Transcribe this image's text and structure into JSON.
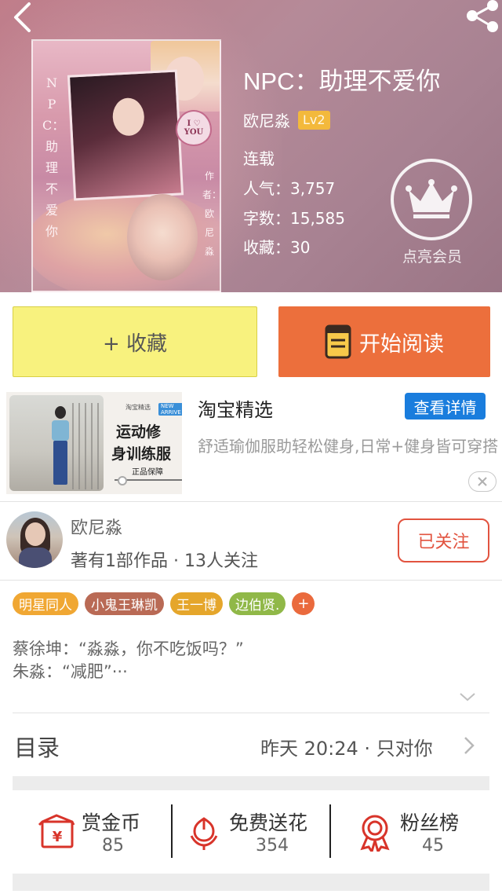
{
  "book": {
    "title": "NPC：助理不爱你",
    "cover_vertical_title": "NPC：助理不爱你",
    "cover_author": "作者：欧尼淼",
    "author": "欧尼淼",
    "level": "Lv2",
    "status": "连载",
    "popularity": "人气：3,757",
    "word_count": "字数：15,585",
    "favorites": "收藏：30",
    "vip_label": "点亮会员"
  },
  "actions": {
    "collect_label": "+ 收藏",
    "read_label": "开始阅读"
  },
  "ad": {
    "title": "淘宝精选",
    "detail_button": "查看详情",
    "description": "舒适瑜伽服助轻松健身,日常+健身皆可穿搭",
    "image_brand": "淘宝精选",
    "image_tag": "NEW ARRIVE",
    "image_line1": "运动修",
    "image_line2": "身训练服",
    "image_badge": "正品保障"
  },
  "author_card": {
    "name": "欧尼淼",
    "stats": "著有1部作品 · 13人关注",
    "follow_label": "已关注"
  },
  "tags": [
    {
      "label": "明星同人",
      "color": "#f0a733"
    },
    {
      "label": "小鬼王琳凯",
      "color": "#b96a55"
    },
    {
      "label": "王一博",
      "color": "#e5a62b"
    },
    {
      "label": "边伯贤.",
      "color": "#90b848"
    }
  ],
  "tag_add_label": "+",
  "synopsis": {
    "line1": "蔡徐坤：“淼淼，你不吃饭吗？”",
    "line2": "朱淼：“减肥”···"
  },
  "toc": {
    "label": "目录",
    "latest": "昨天 20:24 · 只对你"
  },
  "stats": [
    {
      "label": "赏金币",
      "value": "85",
      "icon": "coin-envelope-icon"
    },
    {
      "label": "免费送花",
      "value": "354",
      "icon": "flower-icon"
    },
    {
      "label": "粉丝榜",
      "value": "45",
      "icon": "medal-icon"
    }
  ],
  "colors": {
    "accent_orange": "#ec6f3c",
    "collect_yellow": "#f8f27e",
    "follow_red": "#e2533f",
    "detail_blue": "#1a7ddd",
    "level_gold": "#f3b93c"
  }
}
